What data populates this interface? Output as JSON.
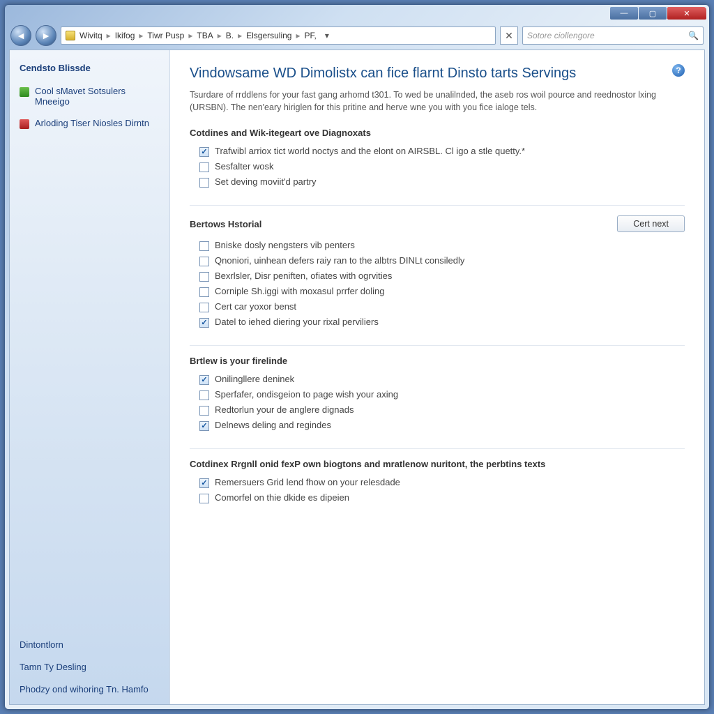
{
  "titlebar": {
    "min": "—",
    "max": "▢",
    "close": "✕"
  },
  "nav": {
    "back": "◄",
    "forward": "►"
  },
  "breadcrumb": [
    "Wivitq",
    "Ikifog",
    "Tiwr Pusp",
    "TBA",
    "B.",
    "Elsgersuling",
    "PF,"
  ],
  "addr_dropdown": "▾",
  "refresh": "✕",
  "search_placeholder": "Sotore ciollengore",
  "search_icon": "🔍",
  "help_glyph": "?",
  "sidebar": {
    "title": "Cendsto Blissde",
    "tasks": [
      {
        "label": "Cool sMavet Sotsulers Mneeigo"
      },
      {
        "label": "Arloding Tiser Niosles Dirntn"
      }
    ],
    "see_also": [
      "Dintontlorn",
      "Tamn Ty Desling",
      "Phodzy ond wihoring Tn. Hamfo"
    ]
  },
  "main": {
    "title": "Vindowsame WD Dimolistx can fice flarnt Dinsto tarts Servings",
    "description": "Tsurdare of rrddlens for your fast gang arhomd t301. To wed be unalilnded, the aseb ros woil pource and reednostor lxing (URSBN). The nen'eary hiriglen for this pritine and herve wne you with you fice ialoge tels.",
    "sections": [
      {
        "heading": "Cotdines and Wik-itegeart ove Diagnoxats",
        "button": null,
        "options": [
          {
            "checked": true,
            "label": "Trafwibl arriox tict world noctys and the elont on AIRSBL. Cl igo a stle quetty.*"
          },
          {
            "checked": false,
            "label": "Sesfalter wosk"
          },
          {
            "checked": false,
            "label": "Set deving moviit'd partry"
          }
        ]
      },
      {
        "heading": "Bertows Hstorial",
        "button": "Cert next",
        "options": [
          {
            "checked": false,
            "label": "Bniske dosly nengsters vib penters"
          },
          {
            "checked": false,
            "label": "Qnoniori, uinhean defers raiy ran to the albtrs DINLt consiledly"
          },
          {
            "checked": false,
            "label": "Bexrlsler, Disr peniften, ofiates with ogrvities"
          },
          {
            "checked": false,
            "label": "Corniple Sh.iggi with moxasul prrfer doling"
          },
          {
            "checked": false,
            "label": "Cert car yoxor benst"
          },
          {
            "checked": true,
            "label": "Datel to iehed diering your rixal perviliers"
          }
        ]
      },
      {
        "heading": "Brtlew is your firelinde",
        "button": null,
        "options": [
          {
            "checked": true,
            "label": "Onilingllere deninek"
          },
          {
            "checked": false,
            "label": "Sperfafer, ondisgeion to page wish your axing"
          },
          {
            "checked": false,
            "label": "Redtorlun your de anglere dignads"
          },
          {
            "checked": true,
            "label": "Delnews deling and regindes"
          }
        ]
      },
      {
        "heading": "Cotdinex Rrgnll onid fexP own biogtons and mratlenow nuritont, the perbtins texts",
        "button": null,
        "options": [
          {
            "checked": true,
            "label": "Remersuers Grid lend fhow on your relesdade"
          },
          {
            "checked": false,
            "label": "Comorfel on thie dkide es dipeien"
          }
        ]
      }
    ]
  }
}
